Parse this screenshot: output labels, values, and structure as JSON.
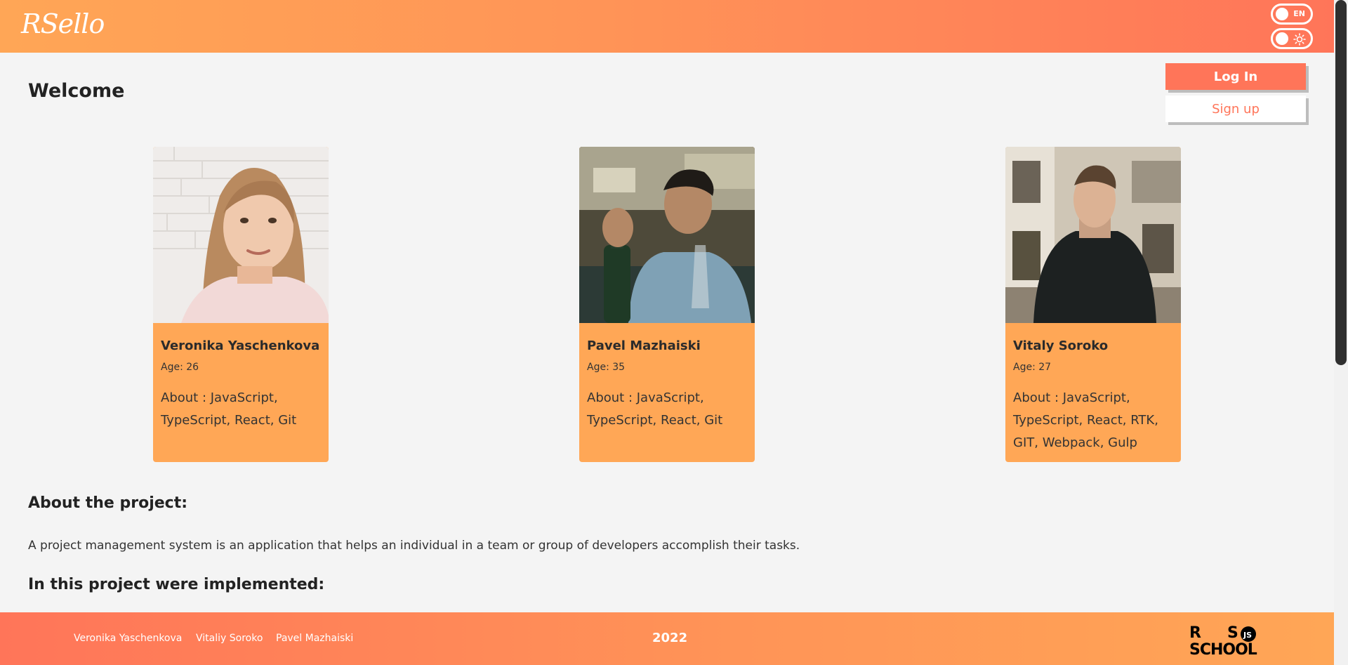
{
  "header": {
    "logo": "RSello",
    "lang_toggle_label": "EN"
  },
  "auth": {
    "login_label": "Log In",
    "signup_label": "Sign up"
  },
  "main": {
    "title": "Welcome",
    "team": [
      {
        "name": "Veronika Yaschenkova",
        "age": "Age: 26",
        "about": "About : JavaScript, TypeScript, React, Git"
      },
      {
        "name": "Pavel Mazhaiski",
        "age": "Age: 35",
        "about": "About : JavaScript, TypeScript, React, Git"
      },
      {
        "name": "Vitaly Soroko",
        "age": "Age: 27",
        "about": "About : JavaScript, TypeScript, React, RTK, GIT, Webpack, Gulp"
      }
    ],
    "about_heading": "About the project:",
    "about_text": "A project management system is an application that helps an individual in a team or group of developers accomplish their tasks.",
    "implemented_heading": "In this project were implemented:"
  },
  "footer": {
    "links": [
      "Veronika Yaschenkova",
      "Vitaliy Soroko",
      "Pavel Mazhaiski"
    ],
    "year": "2022",
    "school_logo": {
      "line1": "R  S",
      "line2": "SCHOOL",
      "badge": "JS"
    }
  },
  "colors": {
    "accent": "#ff7559",
    "card": "#ffa756",
    "background": "#f4f4f4"
  }
}
